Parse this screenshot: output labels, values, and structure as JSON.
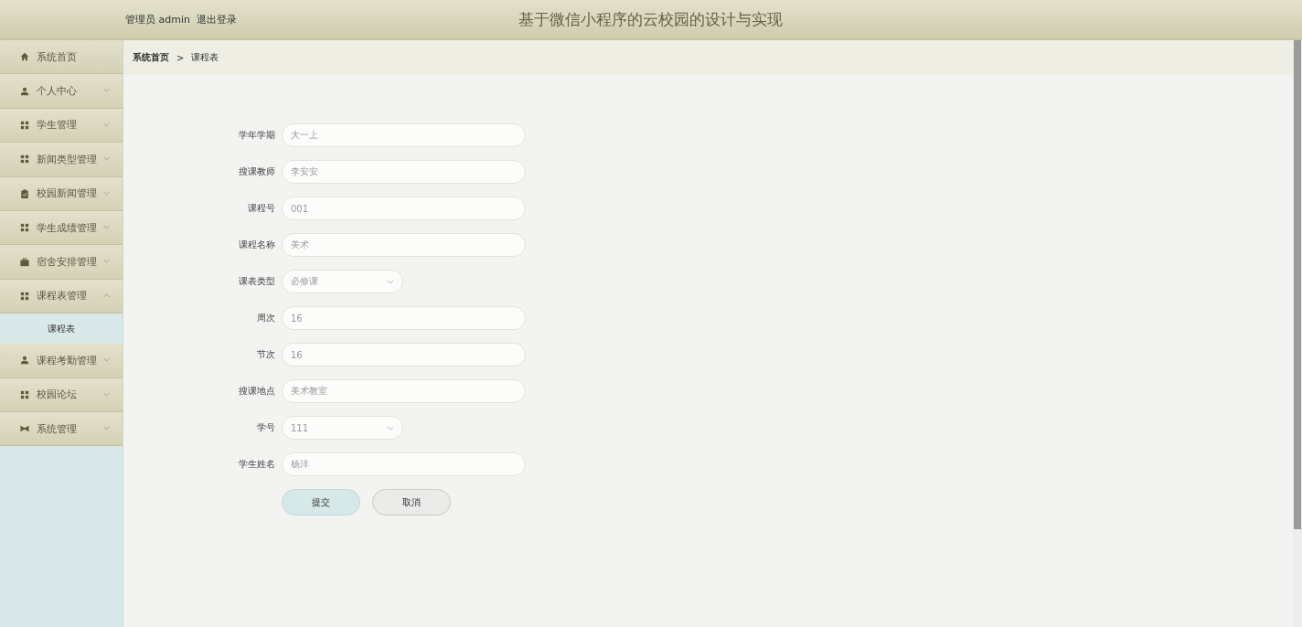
{
  "header": {
    "user": "管理员 admin",
    "logout": "退出登录",
    "title": "基于微信小程序的云校园的设计与实现"
  },
  "sidebar": {
    "items": [
      {
        "label": "系统首页"
      },
      {
        "label": "个人中心",
        "expanded": false
      },
      {
        "label": "学生管理",
        "expanded": false
      },
      {
        "label": "新闻类型管理",
        "expanded": false
      },
      {
        "label": "校园新闻管理",
        "expanded": false
      },
      {
        "label": "学生成绩管理",
        "expanded": false
      },
      {
        "label": "宿舍安排管理",
        "expanded": false
      },
      {
        "label": "课程表管理",
        "expanded": true,
        "children": [
          {
            "label": "课程表"
          }
        ]
      },
      {
        "label": "课程考勤管理",
        "expanded": false
      },
      {
        "label": "校园论坛",
        "expanded": false
      },
      {
        "label": "系统管理",
        "expanded": false
      }
    ]
  },
  "breadcrumb": [
    "系统首页",
    ">",
    "课程表"
  ],
  "form": {
    "fields": [
      {
        "label": "学年学期",
        "kind": "input",
        "value": "大一上"
      },
      {
        "label": "搜课教师",
        "kind": "input",
        "value": "李安安"
      },
      {
        "label": "课程号",
        "kind": "input",
        "value": "001"
      },
      {
        "label": "课程名称",
        "kind": "input",
        "value": "美术"
      },
      {
        "label": "课表类型",
        "kind": "select",
        "value": "必修课"
      },
      {
        "label": "周次",
        "kind": "input",
        "value": "16"
      },
      {
        "label": "节次",
        "kind": "input",
        "value": "16"
      },
      {
        "label": "搜课地点",
        "kind": "input",
        "value": "美术教室"
      },
      {
        "label": "学号",
        "kind": "select",
        "value": "111"
      },
      {
        "label": "学生姓名",
        "kind": "input",
        "value": "杨洋"
      }
    ],
    "buttons": [
      {
        "label": "提交",
        "kind": "primary"
      },
      {
        "label": "取消",
        "kind": "secondary"
      }
    ]
  }
}
